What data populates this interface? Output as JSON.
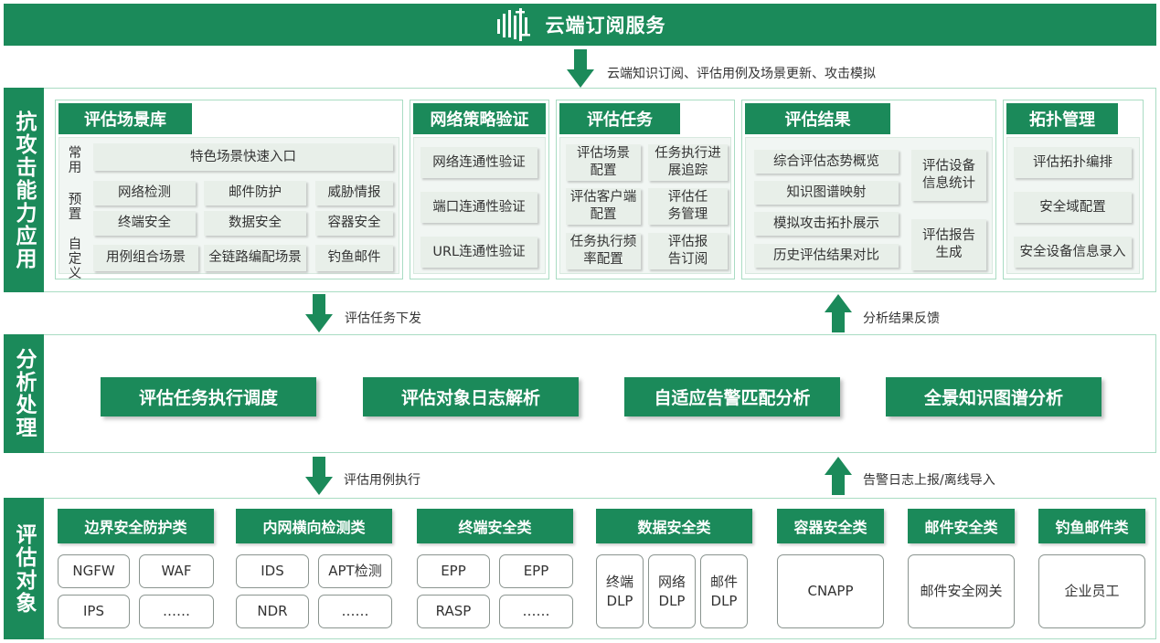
{
  "top": {
    "title": "云端订阅服务",
    "caption": "云端知识订阅、评估用例及场景更新、攻击模拟"
  },
  "layers": {
    "attack": "抗攻击能力应用",
    "analysis": "分析处理",
    "objects": "评估对象"
  },
  "arrows": {
    "dispatch": "评估任务下发",
    "feedback": "分析结果反馈",
    "execute": "评估用例执行",
    "report": "告警日志上报/离线导入"
  },
  "scenario_lib": {
    "title": "评估场景库",
    "row_labels": [
      "常用",
      "预置",
      "自定义"
    ],
    "featured": "特色场景快速入口",
    "preset": [
      "网络检测",
      "邮件防护",
      "威胁情报",
      "终端安全",
      "数据安全",
      "容器安全"
    ],
    "custom": [
      "用例组合场景",
      "全链路编配场景",
      "钓鱼邮件"
    ]
  },
  "policy_verify": {
    "title": "网络策略验证",
    "items": [
      "网络连通性验证",
      "端口连通性验证",
      "URL连通性验证"
    ]
  },
  "eval_task": {
    "title": "评估任务",
    "items": [
      "评估场景配置",
      "任务执行进展追踪",
      "评估客户端配置",
      "评估任务管理",
      "任务执行频率配置",
      "评估报告订阅"
    ]
  },
  "eval_result": {
    "title": "评估结果",
    "left": [
      "综合评估态势概览",
      "知识图谱映射",
      "模拟攻击拓扑展示",
      "历史评估结果对比"
    ],
    "right": [
      "评估设备信息统计",
      "评估报告生成"
    ]
  },
  "topology": {
    "title": "拓扑管理",
    "items": [
      "评估拓扑编排",
      "安全域配置",
      "安全设备信息录入"
    ]
  },
  "analysis": {
    "items": [
      "评估任务执行调度",
      "评估对象日志解析",
      "自适应告警匹配分析",
      "全景知识图谱分析"
    ]
  },
  "objects": {
    "boundary": {
      "title": "边界安全防护类",
      "items": [
        "NGFW",
        "WAF",
        "IPS",
        "……"
      ]
    },
    "lateral": {
      "title": "内网横向检测类",
      "items": [
        "IDS",
        "APT检测",
        "NDR",
        "……"
      ]
    },
    "endpoint": {
      "title": "终端安全类",
      "items": [
        "EPP",
        "EPP",
        "RASP",
        "……"
      ]
    },
    "data": {
      "title": "数据安全类",
      "items": [
        "终端DLP",
        "网络DLP",
        "邮件DLP"
      ]
    },
    "container": {
      "title": "容器安全类",
      "items": [
        "CNAPP"
      ]
    },
    "mail": {
      "title": "邮件安全类",
      "items": [
        "邮件安全网关"
      ]
    },
    "phishing": {
      "title": "钓鱼邮件类",
      "items": [
        "企业员工"
      ]
    }
  },
  "colors": {
    "primary_green": "#1b8a5a",
    "border_green": "#a9dcc3",
    "cell_bg": "#e8efe9"
  }
}
